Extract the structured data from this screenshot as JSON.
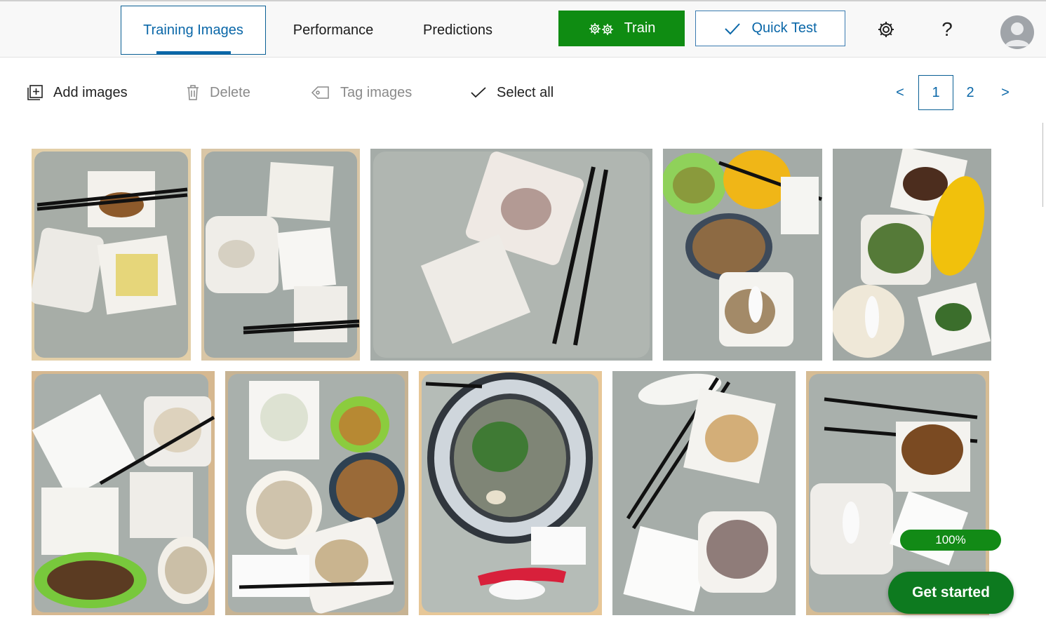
{
  "tabs": [
    {
      "label": "Training Images",
      "active": true
    },
    {
      "label": "Performance",
      "active": false
    },
    {
      "label": "Predictions",
      "active": false
    }
  ],
  "actions": {
    "train_label": "Train",
    "quick_test_label": "Quick Test",
    "settings_icon": "gear-icon",
    "help_label": "?"
  },
  "toolbar": {
    "add_images": "Add images",
    "delete": "Delete",
    "tag_images": "Tag images",
    "select_all": "Select all"
  },
  "pagination": {
    "prev": "<",
    "pages": [
      "1",
      "2"
    ],
    "current": "1",
    "next": ">"
  },
  "progress": {
    "label": "100%",
    "value": 1.0
  },
  "get_started_label": "Get started",
  "colors": {
    "accent": "#0a67a8",
    "train_green": "#0f8c12",
    "progress_green": "#128a16",
    "get_started_green": "#0d7a1f"
  }
}
